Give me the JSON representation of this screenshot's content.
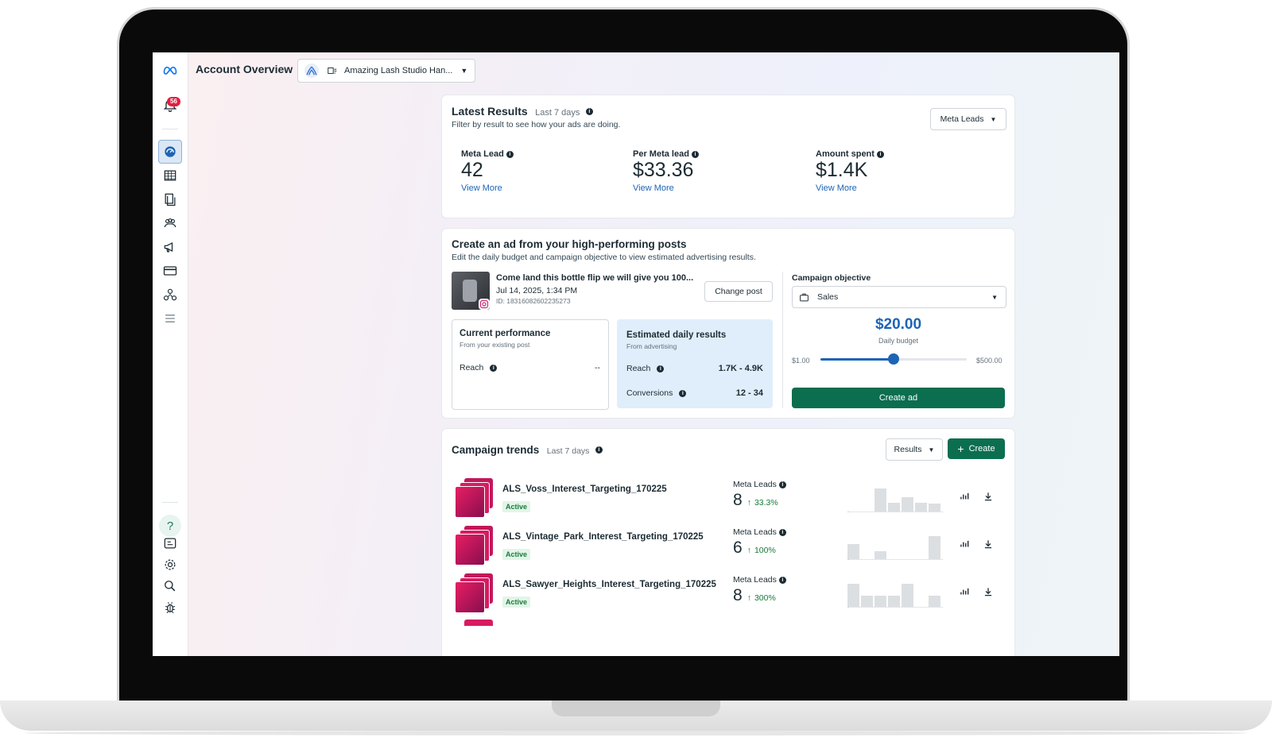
{
  "app": {
    "title": "Account Overview",
    "account_name": "Amazing Lash Studio Han...",
    "notification_count": "56"
  },
  "rail": {
    "icons": [
      "meta-logo-icon",
      "bell-icon",
      "dashboard-icon",
      "table-icon",
      "pages-icon",
      "audiences-icon",
      "megaphone-icon",
      "billing-icon",
      "business-icon",
      "menu-icon",
      "help-icon",
      "id-card-icon",
      "gear-icon",
      "search-icon",
      "bug-icon"
    ],
    "help_glyph": "?"
  },
  "latest": {
    "title": "Latest Results",
    "period": "Last 7 days",
    "subtitle": "Filter by result to see how your ads are doing.",
    "filter_label": "Meta Leads",
    "metrics": [
      {
        "label": "Meta Lead",
        "value": "42",
        "link": "View More"
      },
      {
        "label": "Per Meta lead",
        "value": "$33.36",
        "link": "View More"
      },
      {
        "label": "Amount spent",
        "value": "$1.4K",
        "link": "View More"
      }
    ]
  },
  "create": {
    "title": "Create an ad from your high-performing posts",
    "subtitle": "Edit the daily budget and campaign objective to view estimated advertising results.",
    "post": {
      "caption": "Come land this bottle flip we will give you 100...",
      "date": "Jul 14, 2025, 1:34 PM",
      "id": "ID: 18316082602235273"
    },
    "change_post_label": "Change post",
    "current": {
      "title": "Current performance",
      "subtitle": "From your existing post",
      "reach_label": "Reach",
      "reach_value": "--"
    },
    "estimated": {
      "title": "Estimated daily results",
      "subtitle": "From advertising",
      "reach_label": "Reach",
      "reach_value": "1.7K - 4.9K",
      "conv_label": "Conversions",
      "conv_value": "12 - 34"
    },
    "objective_label": "Campaign objective",
    "objective_value": "Sales",
    "budget_value": "$20.00",
    "budget_label": "Daily budget",
    "budget_min": "$1.00",
    "budget_max": "$500.00",
    "budget_position": 0.5,
    "create_ad_label": "Create ad"
  },
  "trends": {
    "title": "Campaign trends",
    "period": "Last 7 days",
    "results_label": "Results",
    "create_label": "Create",
    "metric_label": "Meta Leads",
    "rows": [
      {
        "name": "ALS_Voss_Interest_Targeting_170225",
        "status": "Active",
        "value": "8",
        "change": "33.3%",
        "bars": [
          0,
          0,
          0.9,
          0.35,
          0.55,
          0.35,
          0.3
        ]
      },
      {
        "name": "ALS_Vintage_Park_Interest_Targeting_170225",
        "status": "Active",
        "value": "6",
        "change": "100%",
        "bars": [
          0.6,
          0,
          0.3,
          0,
          0,
          0,
          0.9
        ]
      },
      {
        "name": "ALS_Sawyer_Heights_Interest_Targeting_170225",
        "status": "Active",
        "value": "8",
        "change": "300%",
        "bars": [
          0.9,
          0.45,
          0.45,
          0.45,
          0.9,
          0,
          0.45
        ]
      }
    ]
  },
  "colors": {
    "accent": "#1d64b5",
    "green": "#0b6e4f",
    "rail_bg": "#ffffff",
    "active_bg": "#dbe7f5"
  }
}
